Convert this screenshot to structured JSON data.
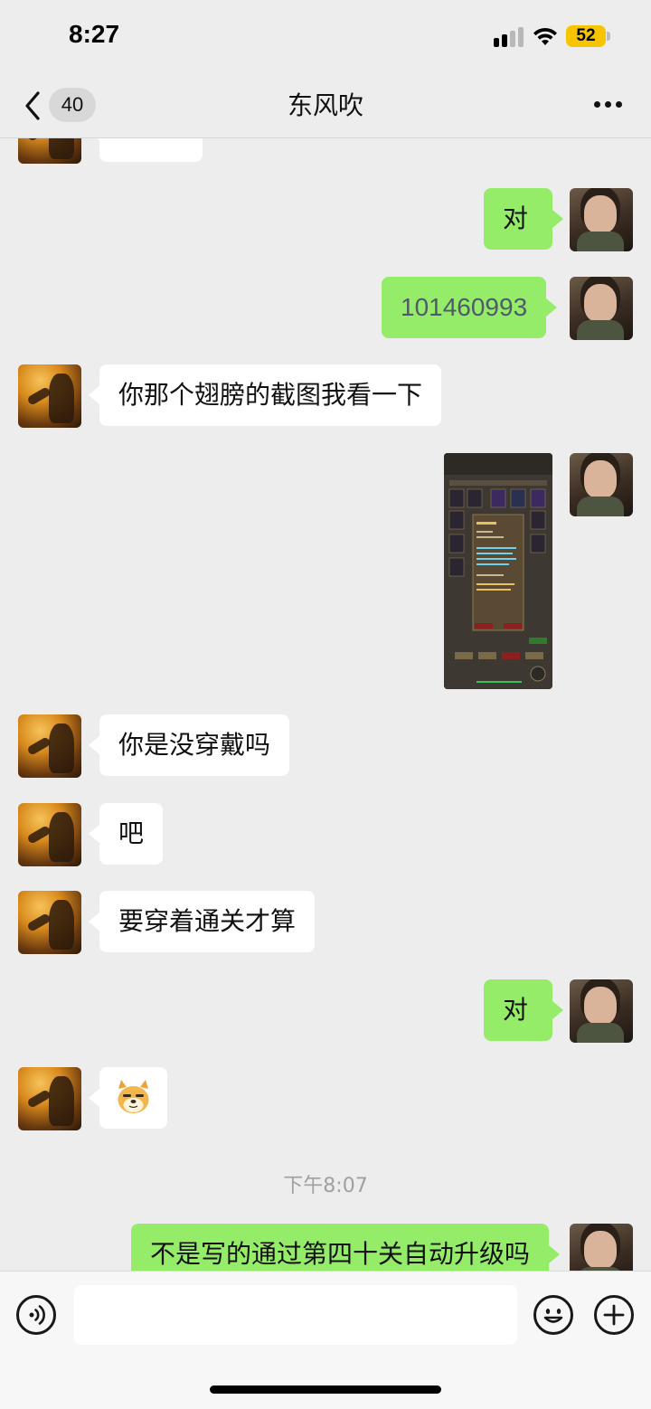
{
  "status_bar": {
    "time": "8:27",
    "battery": "52"
  },
  "header": {
    "back_count": "40",
    "title": "东风吹"
  },
  "messages": [
    {
      "side": "left",
      "text": ""
    },
    {
      "side": "right",
      "text": "对"
    },
    {
      "side": "right",
      "text": "101460993"
    },
    {
      "side": "left",
      "text": "你那个翅膀的截图我看一下"
    },
    {
      "side": "right",
      "type": "image"
    },
    {
      "side": "left",
      "text": "你是没穿戴吗"
    },
    {
      "side": "left",
      "text": "吧"
    },
    {
      "side": "left",
      "text": "要穿着通关才算"
    },
    {
      "side": "right",
      "text": "对"
    },
    {
      "side": "left",
      "type": "sticker"
    },
    {
      "side": "right",
      "text": "不是写的通过第四十关自动升级吗"
    }
  ],
  "timestamp": "下午8:07",
  "composer": {
    "placeholder": ""
  }
}
